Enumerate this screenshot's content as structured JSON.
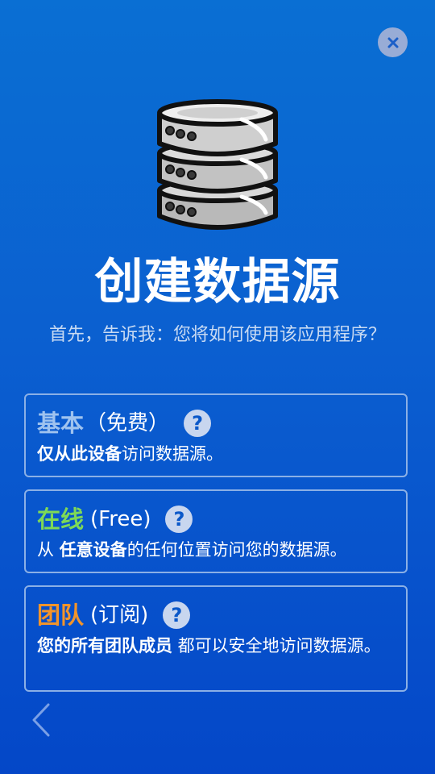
{
  "title": "创建数据源",
  "subtitle": "首先，告诉我：您将如何使用该应用程序？",
  "close_icon": "close-icon",
  "options": [
    {
      "name": "基本",
      "name_color": "#9fc3ef",
      "tag": "（免费）",
      "desc_bold": "仅从此设备",
      "desc_tail": "访问数据源。",
      "desc_head": ""
    },
    {
      "name": "在线",
      "name_color": "#7ed957",
      "tag": "(Free)",
      "desc_head": "从 ",
      "desc_bold": "任意设备",
      "desc_tail": "的任何位置访问您的数据源。"
    },
    {
      "name": "团队",
      "name_color": "#f2942b",
      "tag": "(订阅)",
      "desc_head": "",
      "desc_bold": "您的所有团队成员",
      "desc_tail": " 都可以安全地访问数据源。"
    }
  ],
  "help_glyph": "?",
  "back_icon": "chevron-left-icon"
}
